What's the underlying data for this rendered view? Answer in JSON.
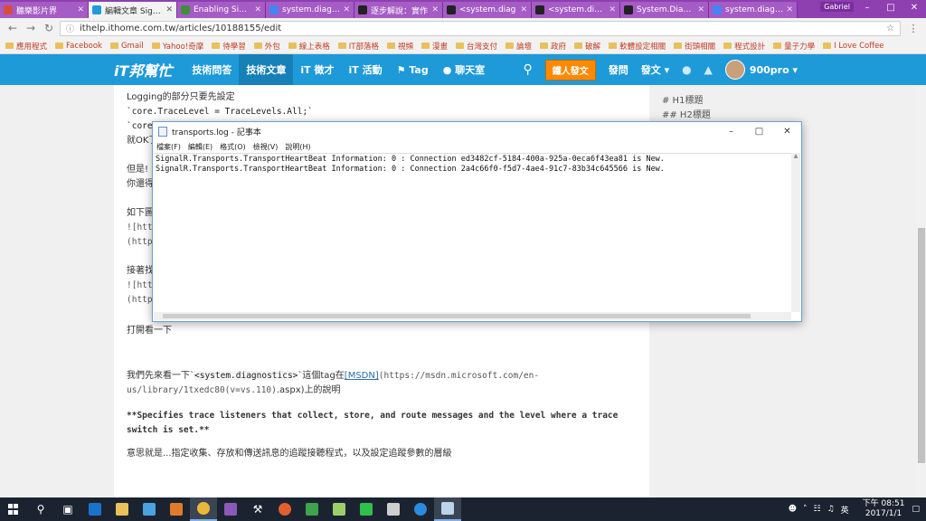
{
  "browser": {
    "tabs": [
      {
        "label": "聽樂影片界",
        "color": "#d94c3d"
      },
      {
        "label": "編輯文章 Signal",
        "color": "#1e9ad8",
        "active": true
      },
      {
        "label": "Enabling Signa",
        "color": "#3f8f3a"
      },
      {
        "label": "system.diagno",
        "color": "#4285f4"
      },
      {
        "label": "逐步解說：實作",
        "color": "#222222"
      },
      {
        "label": "<system.diag",
        "color": "#222222"
      },
      {
        "label": "<system.diagn",
        "color": "#222222"
      },
      {
        "label": "System.Diagno",
        "color": "#222222"
      },
      {
        "label": "system.diagno",
        "color": "#4285f4"
      }
    ],
    "user_badge": "Gabriel",
    "url": "ithelp.ithome.com.tw/articles/10188155/edit",
    "bookmarks": [
      "應用程式",
      "Facebook",
      "Gmail",
      "Yahoo!奇摩",
      "待學習",
      "外包",
      "線上表格",
      "IT部落格",
      "視頻",
      "漫畫",
      "台灣支付",
      "論壇",
      "政府",
      "破解",
      "軟體設定相關",
      "街頭相關",
      "程式設計",
      "量子力學",
      "I Love Coffee"
    ]
  },
  "site": {
    "logo": "iT邦幫忙",
    "nav": [
      "技術問答",
      "技術文章",
      "iT 徵才",
      "iT 活動",
      "Tag",
      "聊天室"
    ],
    "post_button": "鐵人發文",
    "ask_link": "發問",
    "write_menu": "發文 ▾",
    "username": "900pro ▾"
  },
  "article": {
    "line1": "Logging的部分只要先設定",
    "code1": "`core.TraceLevel = TraceLevels.All;`",
    "code2_prefix": "`core",
    "line3_prefix": "就OK了",
    "line4_prefix": "但是!",
    "line5_prefix": "你還得",
    "line6_prefix": "如下圖",
    "link1a": "![htt",
    "link1b": "(http",
    "line7_prefix": "接著找",
    "link2a": "![htt",
    "link2b": "(http",
    "open_look": "打開看一下",
    "para1_a": "我們先來看一下`",
    "para1_code": "<system.diagnostics>",
    "para1_b": "`這個tag在",
    "para1_link": "[MSDN]",
    "para1_url": "(https://msdn.microsoft.com/en-",
    "para1_url2": "us/library/1txedc80(v=vs.110)",
    "para1_c": ".aspx)上的說明",
    "quote": "**Specifies trace listeners that collect, store, and route messages and the level where a trace switch is set.**",
    "para2": "意思就是...指定收集、存放和傳送訊息的追蹤接聽程式，以及設定追蹤參數的層級"
  },
  "toc": [
    "# H1標題",
    "## H2標題"
  ],
  "notepad": {
    "title": "transports.log - 記事本",
    "menu": [
      "檔案(F)",
      "編輯(E)",
      "格式(O)",
      "檢視(V)",
      "說明(H)"
    ],
    "lines": [
      "SignalR.Transports.TransportHeartBeat Information: 0 : Connection ed3482cf-5184-400a-925a-0eca6f43ea81 is New.",
      "SignalR.Transports.TransportHeartBeat Information: 0 : Connection 2a4c66f0-f5d7-4ae4-91c7-83b34c645566 is New."
    ]
  },
  "taskbar": {
    "ime": "英",
    "time": "下午 08:51",
    "date": "2017/1/1"
  }
}
